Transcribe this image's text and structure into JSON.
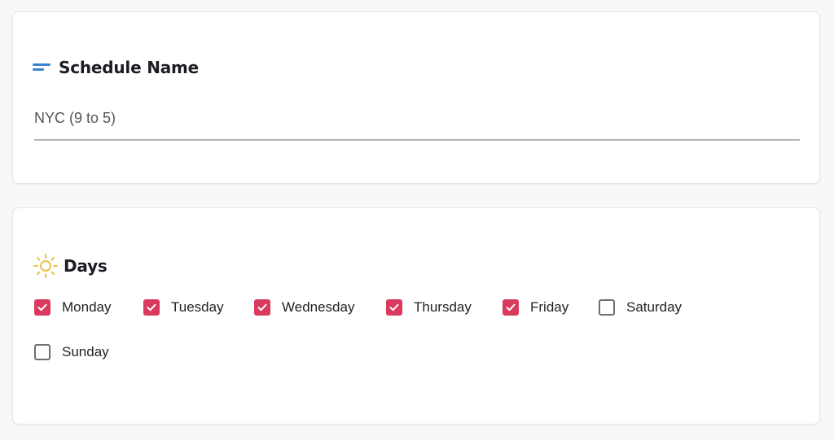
{
  "schedule_name": {
    "title": "Schedule Name",
    "icon": "lines-icon",
    "value": "NYC (9 to 5)",
    "accent": "#3b82d6"
  },
  "days": {
    "title": "Days",
    "icon": "sun-icon",
    "accent": "#d93a5d",
    "items": [
      {
        "label": "Monday",
        "checked": true
      },
      {
        "label": "Tuesday",
        "checked": true
      },
      {
        "label": "Wednesday",
        "checked": true
      },
      {
        "label": "Thursday",
        "checked": true
      },
      {
        "label": "Friday",
        "checked": true
      },
      {
        "label": "Saturday",
        "checked": false
      },
      {
        "label": "Sunday",
        "checked": false
      }
    ]
  }
}
